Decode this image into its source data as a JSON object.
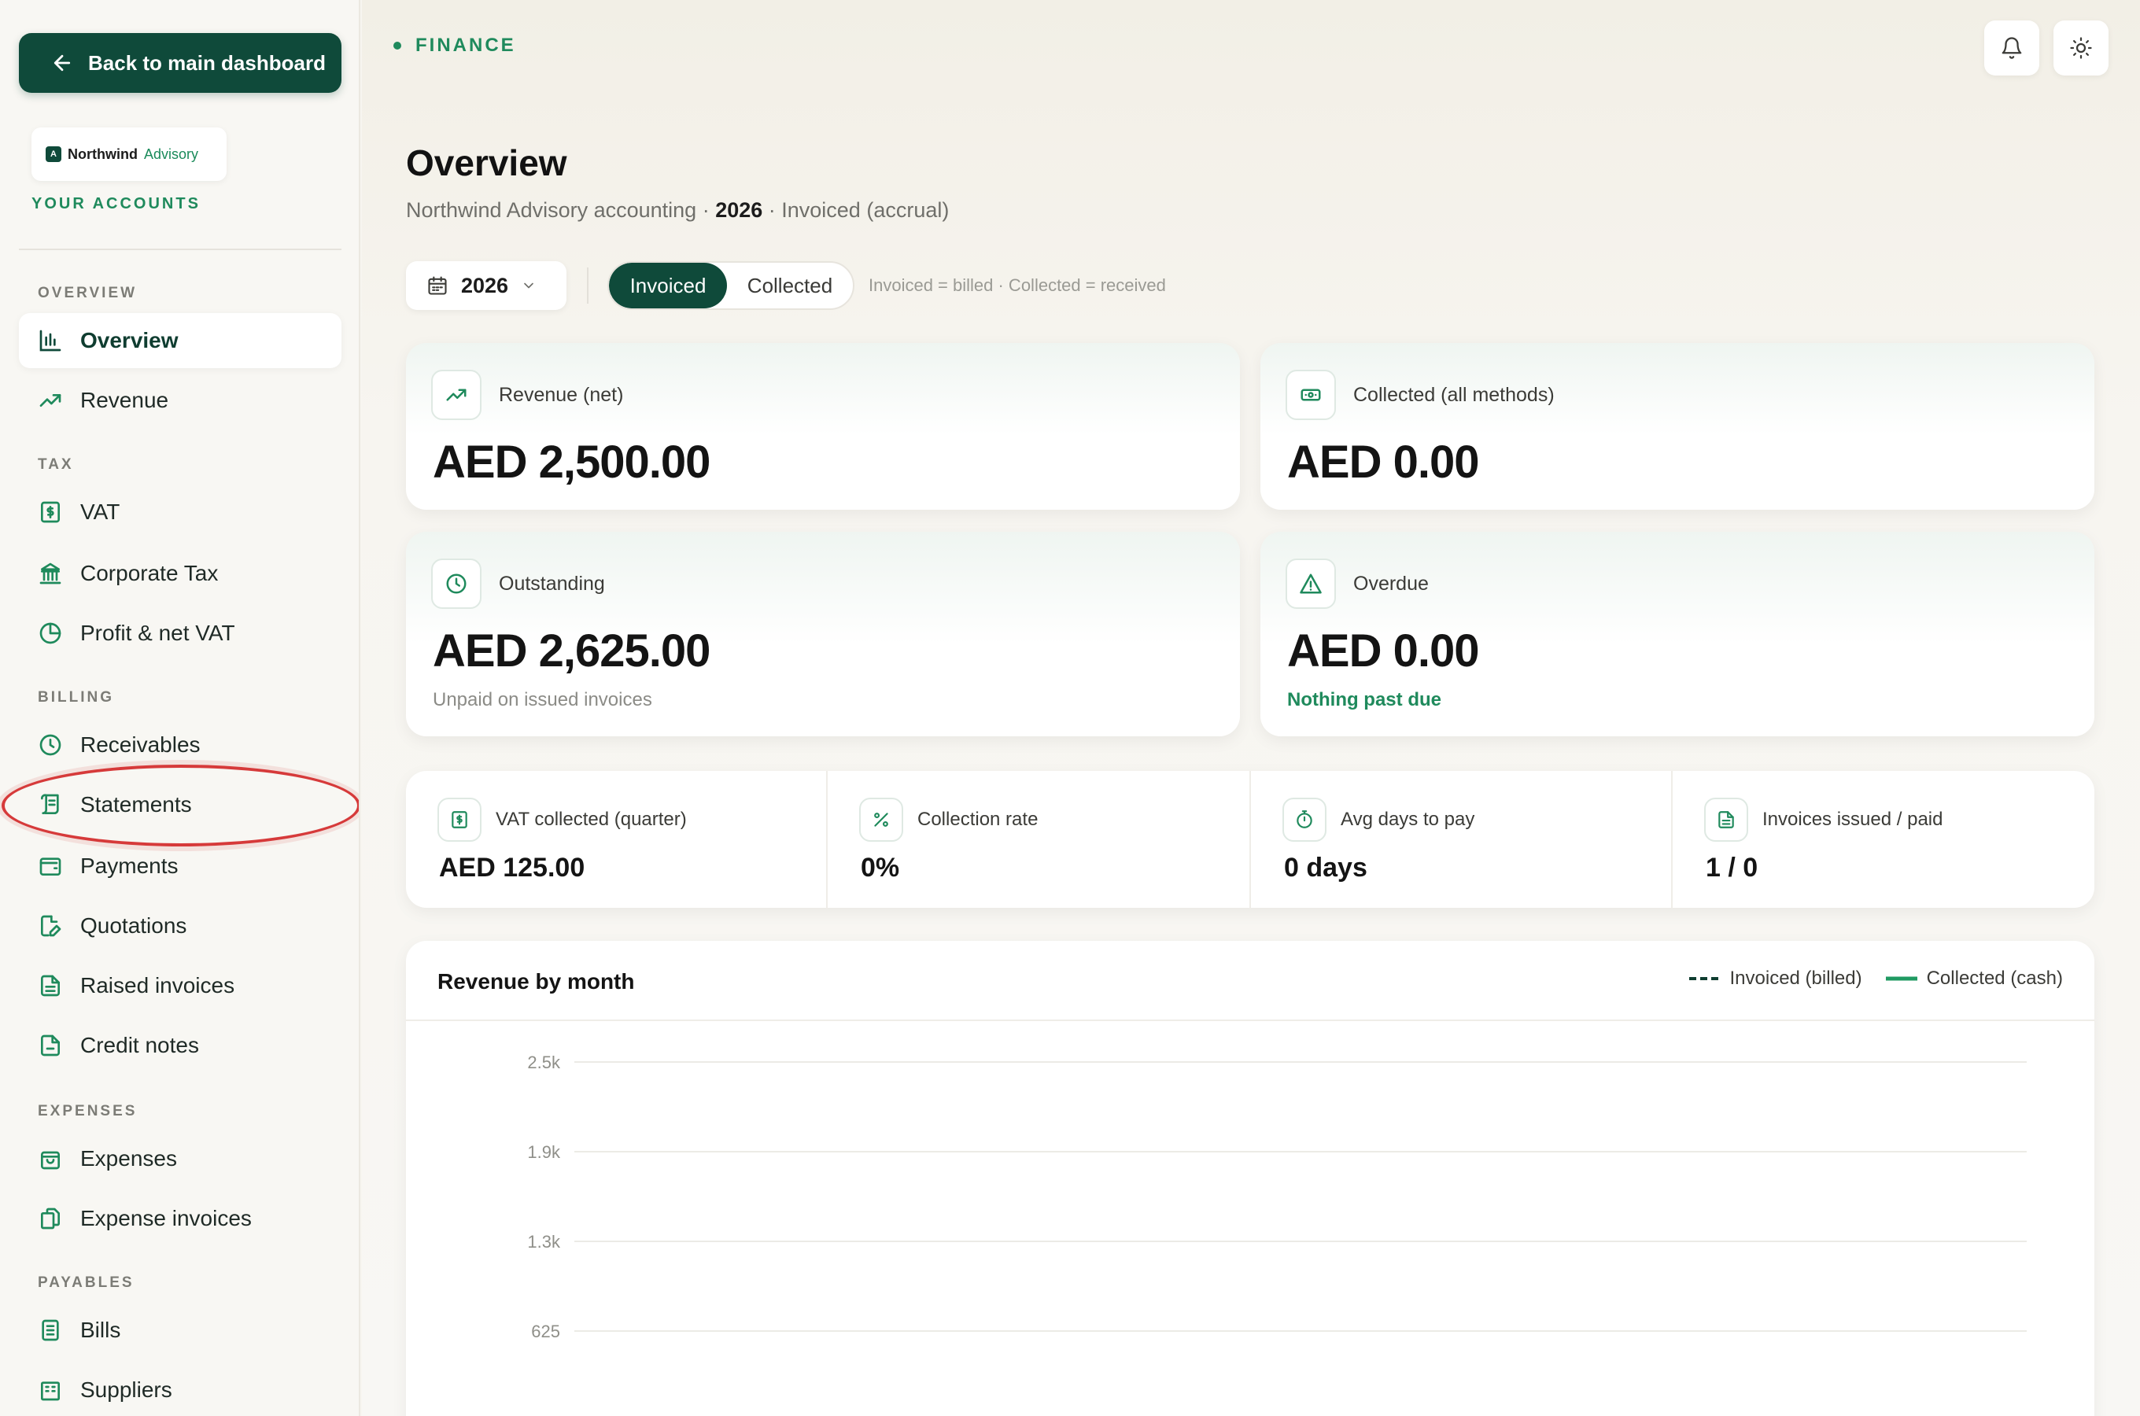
{
  "sidebar": {
    "back_label": "Back to main dashboard",
    "brand": {
      "mark": "A",
      "name": "Northwind",
      "sub": "Advisory"
    },
    "accounts_label": "YOUR ACCOUNTS",
    "sections": {
      "overview": "OVERVIEW",
      "tax": "TAX",
      "billing": "BILLING",
      "expenses": "EXPENSES",
      "payables": "PAYABLES"
    },
    "items": {
      "overview": "Overview",
      "revenue": "Revenue",
      "vat": "VAT",
      "corporate_tax": "Corporate Tax",
      "profit_vat": "Profit & net VAT",
      "receivables": "Receivables",
      "statements": "Statements",
      "payments": "Payments",
      "quotations": "Quotations",
      "raised_invoices": "Raised invoices",
      "credit_notes": "Credit notes",
      "expenses": "Expenses",
      "expense_invoices": "Expense invoices",
      "bills": "Bills",
      "suppliers": "Suppliers"
    },
    "active_item": "overview",
    "highlighted_item": "statements"
  },
  "header": {
    "crumb": "FINANCE",
    "title": "Overview",
    "subtitle_pre": "Northwind Advisory accounting · ",
    "subtitle_year": "2026",
    "subtitle_post": " · Invoiced (accrual)"
  },
  "filters": {
    "year": "2026",
    "toggle": {
      "on": "Invoiced",
      "off": "Collected"
    },
    "hint": "Invoiced = billed · Collected = received"
  },
  "kpis": {
    "revenue": {
      "label": "Revenue (net)",
      "value": "AED 2,500.00",
      "note": ""
    },
    "collected": {
      "label": "Collected (all methods)",
      "value": "AED 0.00",
      "note": ""
    },
    "outstanding": {
      "label": "Outstanding",
      "value": "AED 2,625.00",
      "note": "Unpaid on issued invoices"
    },
    "overdue": {
      "label": "Overdue",
      "value": "AED 0.00",
      "note": "Nothing past due"
    }
  },
  "stats": {
    "vat": {
      "label": "VAT collected (quarter)",
      "value": "AED 125.00"
    },
    "rate": {
      "label": "Collection rate",
      "value": "0%"
    },
    "days": {
      "label": "Avg days to pay",
      "value": "0 days"
    },
    "invoices": {
      "label": "Invoices issued / paid",
      "value": "1 / 0"
    }
  },
  "colors": {
    "brand": "#0f4a3a",
    "accent": "#1f8a5c",
    "highlight": "#d63a3a"
  },
  "chart_data": {
    "type": "line",
    "title": "Revenue by month",
    "series": [
      {
        "name": "Invoiced (billed)",
        "style": "dashed",
        "color": "#0f3d30",
        "values": []
      },
      {
        "name": "Collected (cash)",
        "style": "solid",
        "color": "#1f9a62",
        "values": []
      }
    ],
    "y_ticks": [
      "2.5k",
      "1.9k",
      "1.3k",
      "625"
    ],
    "ylim": [
      0,
      2500
    ],
    "grid": true,
    "legend": "top-right"
  }
}
